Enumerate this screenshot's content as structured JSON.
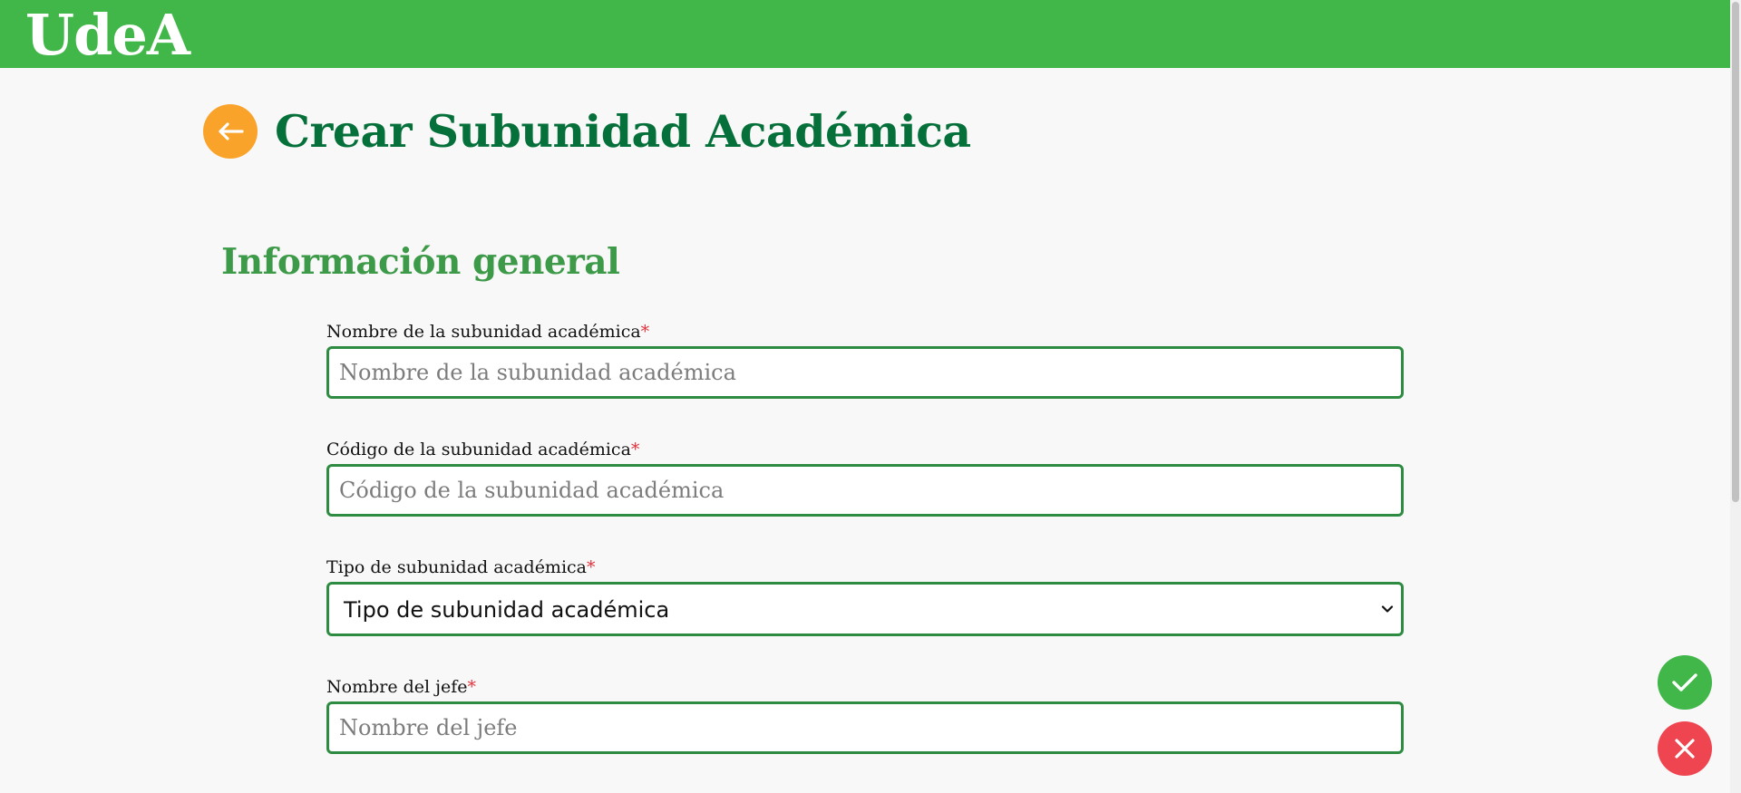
{
  "header": {
    "logo_text": "UdeA"
  },
  "page": {
    "title": "Crear Subunidad Académica"
  },
  "section": {
    "title": "Información general"
  },
  "form": {
    "required_mark": "*",
    "nombre": {
      "label": "Nombre de la subunidad académica",
      "placeholder": "Nombre de la subunidad académica",
      "value": ""
    },
    "codigo": {
      "label": "Código de la subunidad académica",
      "placeholder": "Código de la subunidad académica",
      "value": ""
    },
    "tipo": {
      "label": "Tipo de subunidad académica",
      "selected": "Tipo de subunidad académica"
    },
    "jefe": {
      "label": "Nombre del jefe",
      "placeholder": "Nombre del jefe",
      "value": ""
    }
  },
  "icons": {
    "back": "arrow-left-icon",
    "confirm": "checkmark-icon",
    "cancel": "close-icon",
    "dropdown": "chevron-down-icon"
  },
  "colors": {
    "header_green": "#41b649",
    "title_green": "#05703a",
    "section_green": "#3d9a48",
    "input_border": "#2e8b42",
    "back_orange": "#f9a32a",
    "confirm_green": "#41b649",
    "cancel_red": "#ee4550",
    "required_red": "#e0333c"
  }
}
